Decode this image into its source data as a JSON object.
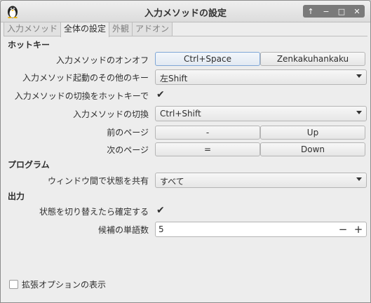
{
  "window": {
    "title": "入力メソッドの設定",
    "controls": [
      "↑",
      "−",
      "□",
      "✕"
    ]
  },
  "tabs": [
    {
      "label": "入力メソッド",
      "active": false
    },
    {
      "label": "全体の設定",
      "active": true
    },
    {
      "label": "外観",
      "active": false
    },
    {
      "label": "アドオン",
      "active": false
    }
  ],
  "sections": {
    "hotkey": {
      "title": "ホットキー",
      "toggle_label": "入力メソッドのオンオフ",
      "toggle_key1": "Ctrl+Space",
      "toggle_key2": "Zenkakuhankaku",
      "extra_label": "入力メソッド起動のその他のキー",
      "extra_value": "左Shift",
      "hotkey_switch_label": "入力メソッドの切換をホットキーで",
      "hotkey_switch_checked": true,
      "switch_label": "入力メソッドの切換",
      "switch_value": "Ctrl+Shift",
      "prev_label": "前のページ",
      "prev_key1": "-",
      "prev_key2": "Up",
      "next_label": "次のページ",
      "next_key1": "=",
      "next_key2": "Down"
    },
    "program": {
      "title": "プログラム",
      "share_label": "ウィンドウ間で状態を共有",
      "share_value": "すべて"
    },
    "output": {
      "title": "出力",
      "commit_label": "状態を切り替えたら確定する",
      "commit_checked": true,
      "candidates_label": "候補の単語数",
      "candidates_value": "5",
      "minus": "−",
      "plus": "+"
    }
  },
  "advanced": {
    "label": "拡張オプションの表示",
    "checked": false
  },
  "colors": {
    "accent_border": "#7fa6d6",
    "background": "#ededed"
  }
}
